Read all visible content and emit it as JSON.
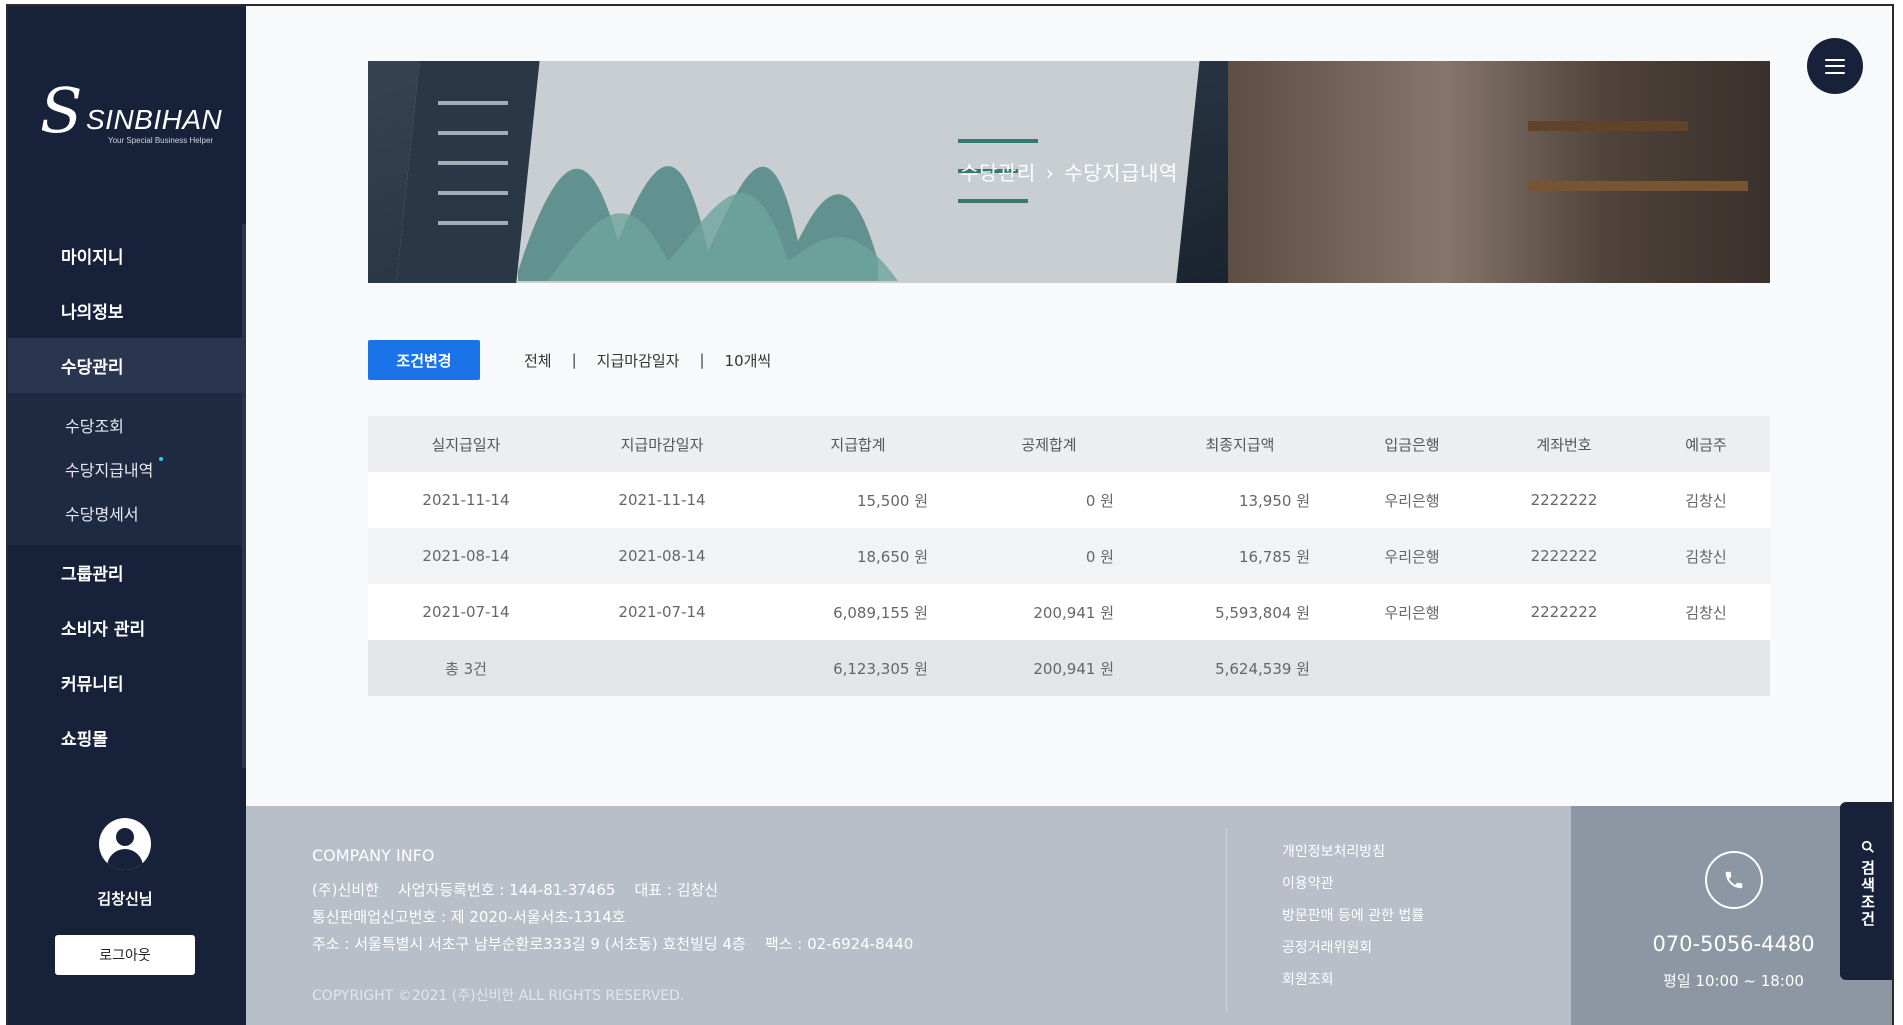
{
  "brand": {
    "name": "SINBIHAN",
    "tagline": "Your Special Business Helper"
  },
  "sidebar": {
    "items": [
      {
        "label": "마이지니"
      },
      {
        "label": "나의정보"
      },
      {
        "label": "수당관리",
        "active": true
      },
      {
        "label": "그룹관리"
      },
      {
        "label": "소비자 관리"
      },
      {
        "label": "커뮤니티"
      },
      {
        "label": "쇼핑몰"
      }
    ],
    "subitems": [
      {
        "label": "수당조회"
      },
      {
        "label": "수당지급내역",
        "current": true
      },
      {
        "label": "수당명세서"
      }
    ],
    "user_name": "김창신님",
    "logout_label": "로그아웃"
  },
  "hero": {
    "crumb_parent": "수당관리",
    "crumb_sep": "›",
    "crumb_current": "수당지급내역"
  },
  "filter": {
    "button_label": "조건변경",
    "tags": [
      "전체",
      "지급마감일자",
      "10개씩"
    ],
    "separator": "|"
  },
  "table": {
    "headers": [
      "실지급일자",
      "지급마감일자",
      "지급합계",
      "공제합계",
      "최종지급액",
      "입금은행",
      "계좌번호",
      "예금주"
    ],
    "rows": [
      [
        "2021-11-14",
        "2021-11-14",
        "15,500 원",
        "0 원",
        "13,950 원",
        "우리은행",
        "2222222",
        "김창신"
      ],
      [
        "2021-08-14",
        "2021-08-14",
        "18,650 원",
        "0 원",
        "16,785 원",
        "우리은행",
        "2222222",
        "김창신"
      ],
      [
        "2021-07-14",
        "2021-07-14",
        "6,089,155 원",
        "200,941 원",
        "5,593,804 원",
        "우리은행",
        "2222222",
        "김창신"
      ]
    ],
    "total": {
      "label": "총 3건",
      "sum_pay": "6,123,305 원",
      "sum_deduct": "200,941 원",
      "sum_final": "5,624,539 원"
    }
  },
  "footer": {
    "info_title": "COMPANY INFO",
    "line1": "(주)신비한    사업자등록번호 : 144-81-37465    대표 : 김창신",
    "line2": "통신판매업신고번호 : 제 2020-서울서초-1314호",
    "line3": "주소 : 서울특별시 서초구 남부순환로333길 9 (서초동) 효천빌딩 4층    팩스 : 02-6924-8440",
    "copyright": "COPYRIGHT ©2021 (주)신비한 ALL RIGHTS RESERVED.",
    "links": [
      "개인정보처리방침",
      "이용약관",
      "방문판매 등에 관한 법률",
      "공정거래위원회",
      "회원조회"
    ],
    "phone": "070-5056-4480",
    "hours": "평일 10:00 ~ 18:00"
  },
  "search_tab_label": "검색조건",
  "icons": {
    "menu": "hamburger-icon",
    "phone": "phone-icon",
    "search": "search-icon",
    "user": "user-icon"
  },
  "colors": {
    "sidebar_bg": "#17223a",
    "accent_blue": "#1a73e8",
    "footer_bg": "#b9bfc8",
    "footer_contact_bg": "#8d96a3"
  }
}
